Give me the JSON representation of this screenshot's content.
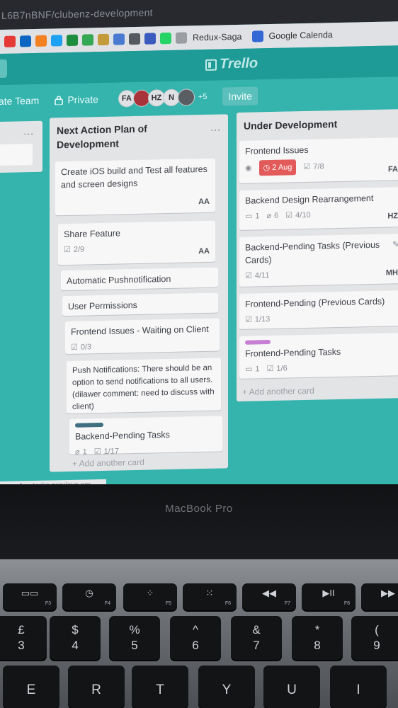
{
  "browser": {
    "url": "L6B7nBNF/clubenz-development"
  },
  "bookmarks": [
    {
      "icon": "youtube-icon",
      "color": "#e53935",
      "label": ""
    },
    {
      "icon": "linkedin-icon",
      "color": "#0a66c2",
      "label": ""
    },
    {
      "icon": "stack-icon",
      "color": "#f48024",
      "label": ""
    },
    {
      "icon": "twitter-icon",
      "color": "#1da1f2",
      "label": ""
    },
    {
      "icon": "sheets-plus-icon",
      "color": "#1e8e3e",
      "label": ""
    },
    {
      "icon": "doc-icon",
      "color": "#34a853",
      "label": ""
    },
    {
      "icon": "folder-icon",
      "color": "#c49b3b",
      "label": ""
    },
    {
      "icon": "globe-icon",
      "color": "#4a7bd0",
      "label": ""
    },
    {
      "icon": "tv-icon",
      "color": "#555a60",
      "label": ""
    },
    {
      "icon": "calendar-icon",
      "color": "#3a5bbd",
      "label": ""
    },
    {
      "icon": "whatsapp-icon",
      "color": "#25d366",
      "label": ""
    },
    {
      "icon": "redux-icon",
      "color": "#9a9da2",
      "label": "Redux-Saga"
    },
    {
      "icon": "google-calendar-icon",
      "color": "#3367d6",
      "label": "Google Calenda"
    }
  ],
  "header": {
    "logo": "Trello"
  },
  "board_bar": {
    "team": "ate Team",
    "visibility": "Private",
    "members": [
      "FA",
      "",
      "HZ",
      "N",
      ""
    ],
    "more_members": "+5",
    "invite": "Invite"
  },
  "lists": {
    "left_partial": {
      "menu": "..."
    },
    "next_action": {
      "title": "Next Action Plan of Development",
      "menu": "...",
      "cards": [
        {
          "title": "Create iOS build and Test all features and screen designs",
          "member": "AA"
        },
        {
          "title": "Share Feature",
          "checklist": "2/9",
          "member": "AA"
        },
        {
          "title": "Automatic Pushnotification"
        },
        {
          "title": "User Permissions"
        },
        {
          "title": "Frontend Issues - Waiting on Client",
          "checklist": "0/3"
        },
        {
          "title": "Push Notifications: There should be an option to send notifications to all users. (dilawer comment: need to discuss with client)"
        },
        {
          "title": "Backend-Pending Tasks",
          "label_color": "#3f6f80",
          "attachments": "1",
          "checklist": "1/17"
        }
      ],
      "add_card": "+ Add another card"
    },
    "under_dev": {
      "title": "Under Development",
      "cards": [
        {
          "title": "Frontend Issues",
          "due": "2 Aug",
          "checklist": "7/8",
          "member": "FA"
        },
        {
          "title": "Backend Design Rearrangement",
          "comments": "1",
          "attachments": "6",
          "checklist": "4/10",
          "member": "HZ"
        },
        {
          "title": "Backend-Pending Tasks (Previous Cards)",
          "checklist": "4/11",
          "member": "MH"
        },
        {
          "title": "Frontend-Pending (Previous Cards)",
          "checklist": "1/13"
        },
        {
          "title": "Frontend-Pending Tasks",
          "label_color": "#c77fd6",
          "comments": "1",
          "checklist": "1/6"
        }
      ],
      "add_card": "+ Add another card"
    }
  },
  "status_bar": {
    "url": "-pending-tasks-previous-car"
  },
  "laptop": {
    "brand": "MacBook Pro",
    "fn_keys": [
      {
        "symbol": "▭▭",
        "label": "F3"
      },
      {
        "symbol": "◷",
        "label": "F4"
      },
      {
        "symbol": "⁘",
        "label": "F5"
      },
      {
        "symbol": "⁙",
        "label": "F6"
      },
      {
        "symbol": "◀◀",
        "label": "F7"
      },
      {
        "symbol": "▶II",
        "label": "F8"
      },
      {
        "symbol": "▶▶",
        "label": ""
      }
    ],
    "num_keys": [
      {
        "top": "£",
        "bottom": "3"
      },
      {
        "top": "$",
        "bottom": "4"
      },
      {
        "top": "%",
        "bottom": "5"
      },
      {
        "top": "^",
        "bottom": "6"
      },
      {
        "top": "&",
        "bottom": "7"
      },
      {
        "top": "*",
        "bottom": "8"
      },
      {
        "top": "(",
        "bottom": "9"
      }
    ],
    "letter_keys": [
      "E",
      "R",
      "T",
      "Y",
      "U",
      "I"
    ]
  }
}
